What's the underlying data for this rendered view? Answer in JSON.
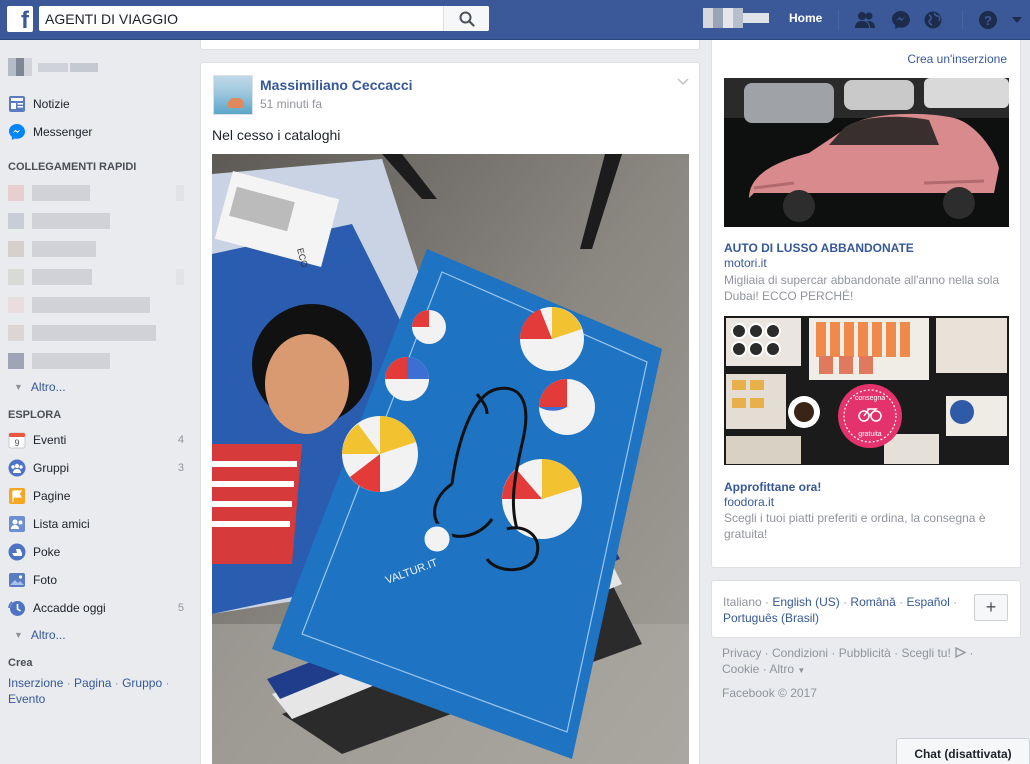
{
  "colors": {
    "brand": "#3b5998",
    "link": "#365899",
    "muted": "#90949c"
  },
  "topbar": {
    "logo_letter": "f",
    "search": {
      "value": "AGENTI DI VIAGGIO",
      "icon": "search-icon"
    },
    "home_label": "Home",
    "icons": [
      "friend-requests-icon",
      "messenger-icon",
      "notifications-globe-icon",
      "help-icon",
      "account-menu-caret-icon"
    ]
  },
  "leftnav": {
    "items": [
      {
        "label": "Notizie",
        "icon": "news-feed-icon"
      },
      {
        "label": "Messenger",
        "icon": "messenger-icon"
      }
    ],
    "shortcuts_heading": "COLLEGAMENTI RAPIDI",
    "more1": "Altro...",
    "explore_heading": "ESPLORA",
    "explore": [
      {
        "label": "Eventi",
        "count": "4",
        "icon": "calendar-icon",
        "badge": "9"
      },
      {
        "label": "Gruppi",
        "count": "3",
        "icon": "groups-icon"
      },
      {
        "label": "Pagine",
        "count": "",
        "icon": "flag-icon"
      },
      {
        "label": "Lista amici",
        "count": "",
        "icon": "friend-list-icon"
      },
      {
        "label": "Poke",
        "count": "",
        "icon": "poke-icon"
      },
      {
        "label": "Foto",
        "count": "",
        "icon": "photos-icon"
      },
      {
        "label": "Accadde oggi",
        "count": "5",
        "icon": "on-this-day-icon"
      }
    ],
    "more2": "Altro...",
    "create_heading": "Crea",
    "create_links": [
      "Inserzione",
      "Pagina",
      "Gruppo",
      "Evento"
    ]
  },
  "post": {
    "author": "Massimiliano Ceccacci",
    "time": "51 minuti fa",
    "text": "Nel cesso i cataloghi",
    "photo_label_1": "VALTUR.IT",
    "photo_label_2": "ECO"
  },
  "ads": {
    "create_label": "Crea un'inserzione",
    "items": [
      {
        "title": "AUTO DI LUSSO ABBANDONATE",
        "domain": "motori.it",
        "desc": "Migliaia di supercar abbandonate all'anno nella sola Dubai! ECCO PERCHÉ!"
      },
      {
        "title": "Approfittane ora!",
        "domain": "foodora.it",
        "desc": "Scegli i tuoi piatti preferiti e ordina, la consegna è gratuita!",
        "badge_line1": "consegna",
        "badge_line2": "gratuita"
      }
    ]
  },
  "languages": {
    "current": "Italiano",
    "others": [
      "English (US)",
      "Română",
      "Español",
      "Português (Brasil)"
    ],
    "add_label": "+"
  },
  "footer": {
    "links": [
      "Privacy",
      "Condizioni",
      "Pubblicità",
      "Scegli tu!",
      "Cookie",
      "Altro"
    ],
    "copyright": "Facebook © 2017"
  },
  "chat": {
    "label": "Chat (disattivata)"
  }
}
